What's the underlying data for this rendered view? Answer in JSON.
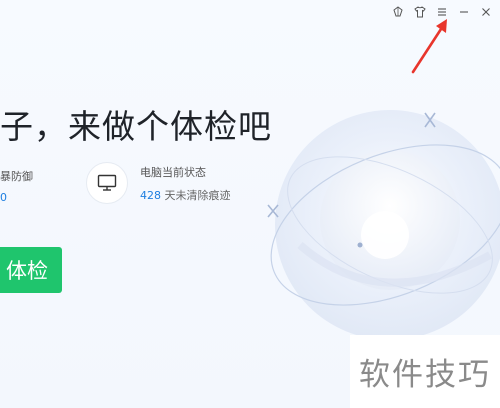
{
  "window": {
    "controls": [
      {
        "name": "skin-icon"
      },
      {
        "name": "shirt-icon"
      },
      {
        "name": "menu-icon"
      },
      {
        "name": "minimize-icon"
      },
      {
        "name": "close-icon"
      }
    ]
  },
  "main": {
    "headline": "子，来做个体检吧",
    "defense_card": {
      "label": "暴防御",
      "sub": "0"
    },
    "status_card": {
      "icon": "monitor-icon",
      "label": "电脑当前状态",
      "days": "428",
      "days_suffix": "天未清除痕迹"
    },
    "check_button": "体检"
  },
  "watermark": "软件技巧",
  "colors": {
    "accent_blue": "#1f7fe0",
    "button_green": "#1fc56d",
    "arrow_red": "#e8352c"
  }
}
